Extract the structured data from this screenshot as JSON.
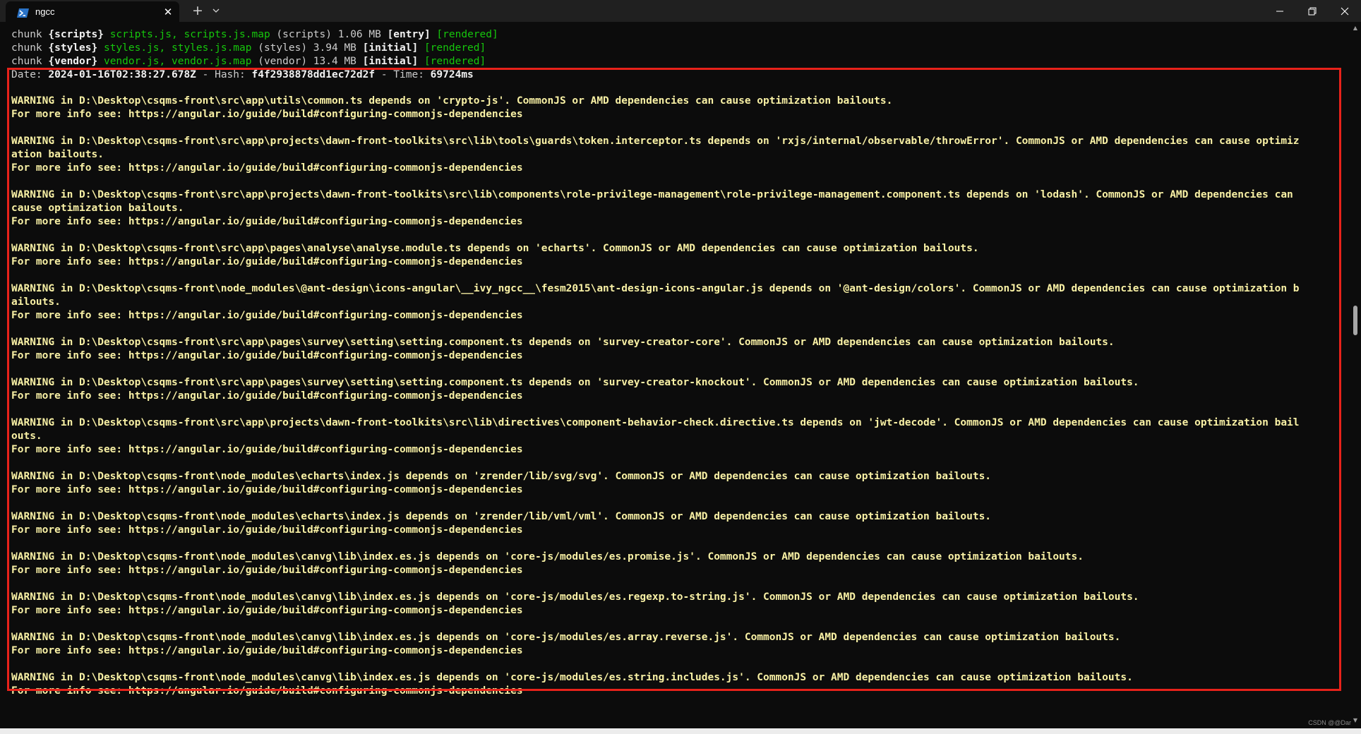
{
  "window": {
    "tab_title": "ngcc",
    "tab_close_glyph": "✕",
    "new_tab_glyph": "+",
    "icons": [
      "powershell-icon",
      "close-icon",
      "plus-icon",
      "chevron-down-icon",
      "minimize-icon",
      "maximize-icon",
      "close-window-icon"
    ]
  },
  "build_output": {
    "chunk_label": "chunk",
    "chunks": [
      {
        "name": "{scripts}",
        "files": "scripts.js, scripts.js.map",
        "group": "(scripts)",
        "size": "1.06 MB",
        "flag": "[entry]",
        "status": "[rendered]"
      },
      {
        "name": "{styles}",
        "files": "styles.js, styles.js.map",
        "group": "(styles)",
        "size": "3.94 MB",
        "flag": "[initial]",
        "status": "[rendered]"
      },
      {
        "name": "{vendor}",
        "files": "vendor.js, vendor.js.map",
        "group": "(vendor)",
        "size": "13.4 MB",
        "flag": "[initial]",
        "status": "[rendered]"
      }
    ],
    "summary": {
      "date_label": "Date:",
      "date": "2024-01-16T02:38:27.678Z",
      "hash_label": "- Hash:",
      "hash": "f4f2938878dd1ec72d2f",
      "time_label": "- Time:",
      "time": "69724ms"
    }
  },
  "warnings": [
    {
      "lines": [
        "WARNING in D:\\Desktop\\csqms-front\\src\\app\\utils\\common.ts depends on 'crypto-js'. CommonJS or AMD dependencies can cause optimization bailouts.",
        "For more info see: https://angular.io/guide/build#configuring-commonjs-dependencies"
      ]
    },
    {
      "lines": [
        "WARNING in D:\\Desktop\\csqms-front\\src\\app\\projects\\dawn-front-toolkits\\src\\lib\\tools\\guards\\token.interceptor.ts depends on 'rxjs/internal/observable/throwError'. CommonJS or AMD dependencies can cause optimiz",
        "ation bailouts.",
        "For more info see: https://angular.io/guide/build#configuring-commonjs-dependencies"
      ]
    },
    {
      "lines": [
        "WARNING in D:\\Desktop\\csqms-front\\src\\app\\projects\\dawn-front-toolkits\\src\\lib\\components\\role-privilege-management\\role-privilege-management.component.ts depends on 'lodash'. CommonJS or AMD dependencies can",
        "cause optimization bailouts.",
        "For more info see: https://angular.io/guide/build#configuring-commonjs-dependencies"
      ]
    },
    {
      "lines": [
        "WARNING in D:\\Desktop\\csqms-front\\src\\app\\pages\\analyse\\analyse.module.ts depends on 'echarts'. CommonJS or AMD dependencies can cause optimization bailouts.",
        "For more info see: https://angular.io/guide/build#configuring-commonjs-dependencies"
      ]
    },
    {
      "lines": [
        "WARNING in D:\\Desktop\\csqms-front\\node_modules\\@ant-design\\icons-angular\\__ivy_ngcc__\\fesm2015\\ant-design-icons-angular.js depends on '@ant-design/colors'. CommonJS or AMD dependencies can cause optimization b",
        "ailouts.",
        "For more info see: https://angular.io/guide/build#configuring-commonjs-dependencies"
      ]
    },
    {
      "lines": [
        "WARNING in D:\\Desktop\\csqms-front\\src\\app\\pages\\survey\\setting\\setting.component.ts depends on 'survey-creator-core'. CommonJS or AMD dependencies can cause optimization bailouts.",
        "For more info see: https://angular.io/guide/build#configuring-commonjs-dependencies"
      ]
    },
    {
      "lines": [
        "WARNING in D:\\Desktop\\csqms-front\\src\\app\\pages\\survey\\setting\\setting.component.ts depends on 'survey-creator-knockout'. CommonJS or AMD dependencies can cause optimization bailouts.",
        "For more info see: https://angular.io/guide/build#configuring-commonjs-dependencies"
      ]
    },
    {
      "lines": [
        "WARNING in D:\\Desktop\\csqms-front\\src\\app\\projects\\dawn-front-toolkits\\src\\lib\\directives\\component-behavior-check.directive.ts depends on 'jwt-decode'. CommonJS or AMD dependencies can cause optimization bail",
        "outs.",
        "For more info see: https://angular.io/guide/build#configuring-commonjs-dependencies"
      ]
    },
    {
      "lines": [
        "WARNING in D:\\Desktop\\csqms-front\\node_modules\\echarts\\index.js depends on 'zrender/lib/svg/svg'. CommonJS or AMD dependencies can cause optimization bailouts.",
        "For more info see: https://angular.io/guide/build#configuring-commonjs-dependencies"
      ]
    },
    {
      "lines": [
        "WARNING in D:\\Desktop\\csqms-front\\node_modules\\echarts\\index.js depends on 'zrender/lib/vml/vml'. CommonJS or AMD dependencies can cause optimization bailouts.",
        "For more info see: https://angular.io/guide/build#configuring-commonjs-dependencies"
      ]
    },
    {
      "lines": [
        "WARNING in D:\\Desktop\\csqms-front\\node_modules\\canvg\\lib\\index.es.js depends on 'core-js/modules/es.promise.js'. CommonJS or AMD dependencies can cause optimization bailouts.",
        "For more info see: https://angular.io/guide/build#configuring-commonjs-dependencies"
      ]
    },
    {
      "lines": [
        "WARNING in D:\\Desktop\\csqms-front\\node_modules\\canvg\\lib\\index.es.js depends on 'core-js/modules/es.regexp.to-string.js'. CommonJS or AMD dependencies can cause optimization bailouts.",
        "For more info see: https://angular.io/guide/build#configuring-commonjs-dependencies"
      ]
    },
    {
      "lines": [
        "WARNING in D:\\Desktop\\csqms-front\\node_modules\\canvg\\lib\\index.es.js depends on 'core-js/modules/es.array.reverse.js'. CommonJS or AMD dependencies can cause optimization bailouts.",
        "For more info see: https://angular.io/guide/build#configuring-commonjs-dependencies"
      ]
    },
    {
      "lines": [
        "WARNING in D:\\Desktop\\csqms-front\\node_modules\\canvg\\lib\\index.es.js depends on 'core-js/modules/es.string.includes.js'. CommonJS or AMD dependencies can cause optimization bailouts.",
        "For more info see: https://angular.io/guide/build#configuring-commonjs-dependencies"
      ]
    }
  ],
  "colors": {
    "background": "#0c0c0c",
    "titlebar": "#202020",
    "default_text": "#cccccc",
    "green_text": "#16c60c",
    "warning_text": "#f9f1a5",
    "highlight_border": "#e8221a"
  },
  "watermark": "CSDN @@Dar"
}
